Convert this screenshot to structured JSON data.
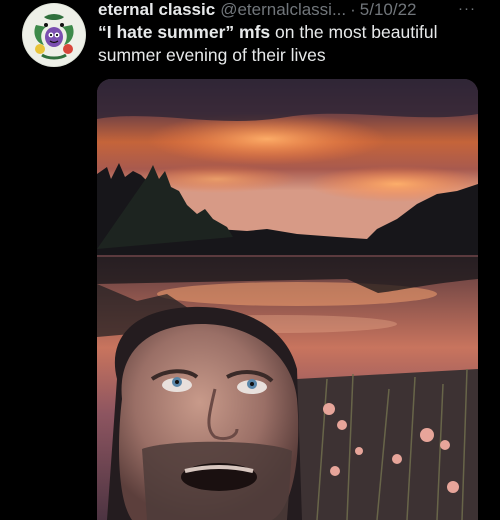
{
  "tweet": {
    "display_name": "eternal classic",
    "handle": "@eternalclassi...",
    "separator": "·",
    "date": "5/10/22",
    "more_glyph": "···",
    "text_bold_1": "“I hate summer” mfs",
    "text_rest": " on the most beautiful summer evening of their lives"
  },
  "icons": {
    "avatar": "cartoon-characters-avatar",
    "more": "more-options-icon"
  },
  "media": {
    "description_icon": "photo",
    "colors": {
      "sky_top": "#3b2a3e",
      "sunset_orange": "#f08a3a",
      "lake": "#5c3a48",
      "trees": "#141418"
    }
  }
}
